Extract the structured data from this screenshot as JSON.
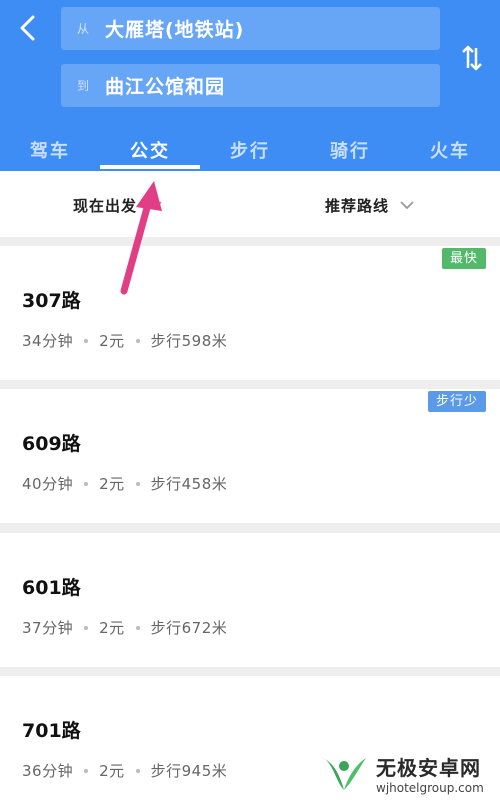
{
  "header": {
    "from_prefix": "从",
    "from_value": "大雁塔(地铁站)",
    "to_prefix": "到",
    "to_value": "曲江公馆和园",
    "tabs": [
      {
        "label": "驾车"
      },
      {
        "label": "公交"
      },
      {
        "label": "步行"
      },
      {
        "label": "骑行"
      },
      {
        "label": "火车"
      }
    ],
    "active_tab": "公交"
  },
  "filters": {
    "time_label": "现在出发",
    "sort_label": "推荐路线"
  },
  "routes": [
    {
      "name": "307路",
      "duration": "34分钟",
      "fare": "2元",
      "walk": "步行598米",
      "badge": "最快"
    },
    {
      "name": "609路",
      "duration": "40分钟",
      "fare": "2元",
      "walk": "步行458米",
      "badge": "步行少"
    },
    {
      "name": "601路",
      "duration": "37分钟",
      "fare": "2元",
      "walk": "步行672米",
      "badge": ""
    },
    {
      "name": "701路",
      "duration": "36分钟",
      "fare": "2元",
      "walk": "步行945米",
      "badge": ""
    }
  ],
  "watermark": {
    "title": "无极安卓网",
    "url": "wjhotelgroup.com"
  },
  "icons": {
    "back": "chevron-left-icon",
    "swap": "swap-vertical-icon",
    "dropdown": "chevron-down-icon",
    "annotation": "arrow-annotation-icon"
  },
  "colors": {
    "header_bg": "#3d8df5",
    "badge_fast": "#52b96a",
    "badge_walk": "#5a9ae8",
    "annotation": "#e23e86"
  }
}
